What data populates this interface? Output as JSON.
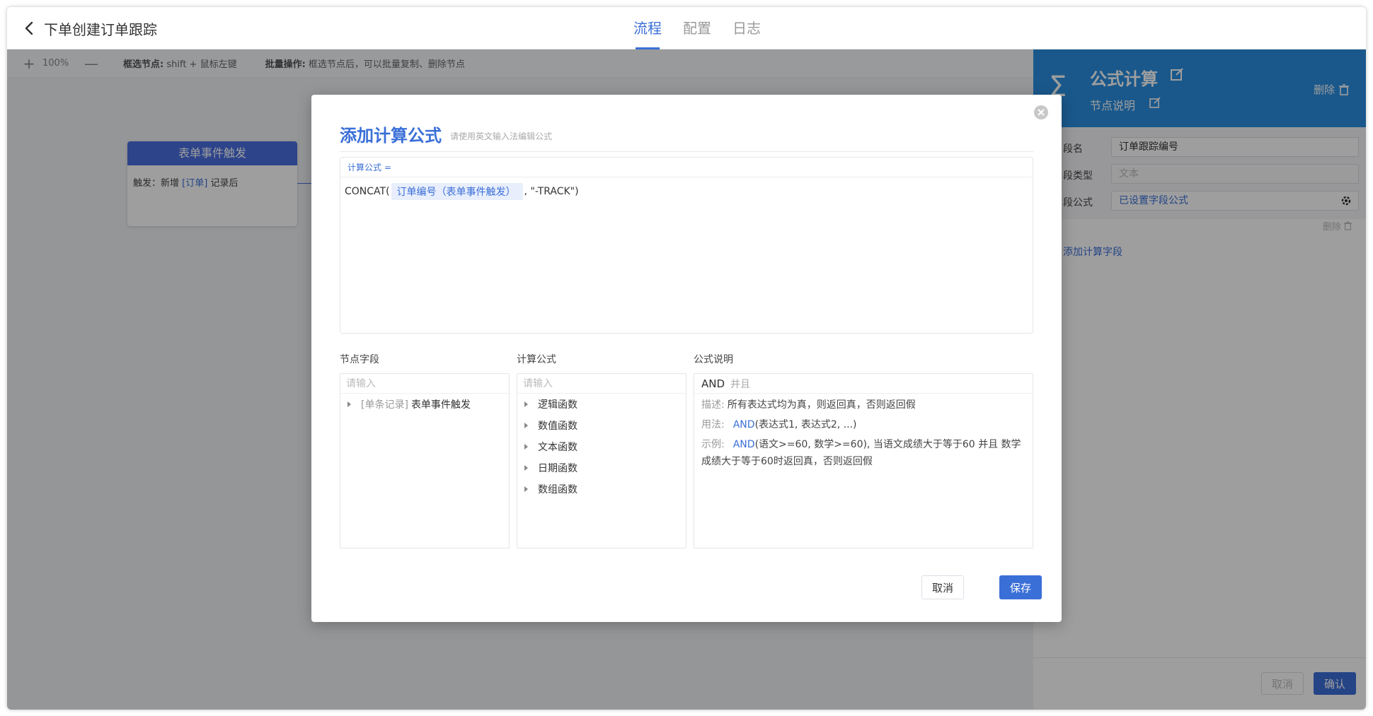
{
  "header": {
    "title": "下单创建订单跟踪",
    "tabs": [
      {
        "label": "流程"
      },
      {
        "label": "配置"
      },
      {
        "label": "日志"
      }
    ]
  },
  "toolbar": {
    "zoom": "100%",
    "hint1_key": "框选节点:",
    "hint1_text": "shift + 鼠标左键",
    "hint2_key": "批量操作:",
    "hint2_text": "框选节点后，可以批量复制、删除节点"
  },
  "trigger_node": {
    "title": "表单事件触发",
    "prefix": "触发：新增",
    "form": "[订单]",
    "suffix": "记录后"
  },
  "right_panel": {
    "title": "公式计算",
    "subtitle": "节点说明",
    "delete_label": "删除",
    "fields": [
      {
        "label": "段名",
        "value": "订单跟踪编号"
      },
      {
        "label": "段类型",
        "value": "文本"
      },
      {
        "label": "段公式",
        "value": "已设置字段公式"
      }
    ],
    "row_delete": "删除",
    "add_field": "添加计算字段",
    "cancel": "取消",
    "confirm": "确认"
  },
  "modal": {
    "title": "添加计算公式",
    "subtitle": "请使用英文输入法编辑公式",
    "editor_label": "计算公式 =",
    "formula_prefix": "CONCAT(",
    "formula_chip": "订单编号（表单事件触发）",
    "formula_suffix": ", \"-TRACK\")",
    "columns": {
      "fields_label": "节点字段",
      "formulas_label": "计算公式",
      "desc_label": "公式说明"
    },
    "search_placeholder": "请输入",
    "field_tree": [
      {
        "tag": "[单条记录]",
        "name": "表单事件触发"
      }
    ],
    "formula_categories": [
      "逻辑函数",
      "数值函数",
      "文本函数",
      "日期函数",
      "数组函数"
    ],
    "description": {
      "name": "AND",
      "name_cn": "并且",
      "desc_key": "描述:",
      "desc_text": "所有表达式均为真，则返回真，否则返回假",
      "usage_key": "用法:",
      "usage_fn": "AND",
      "usage_text": "(表达式1, 表达式2, ...)",
      "example_key": "示例:",
      "example_fn": "AND",
      "example_text": "(语文>=60, 数学>=60), 当语文成绩大于等于60 并且 数学成绩大于等于60时返回真，否则返回假"
    },
    "cancel": "取消",
    "save": "保存"
  },
  "colors": {
    "accent": "#3a6fd8",
    "panel_header": "#2b8fe0",
    "node_header": "#4a6ee0"
  }
}
